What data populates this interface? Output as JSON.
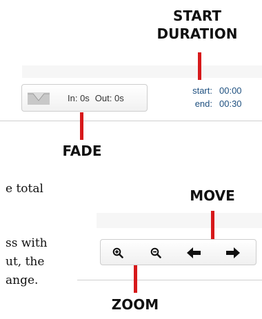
{
  "callouts": {
    "start_duration_line1": "START",
    "start_duration_line2": "DURATION",
    "fade": "FADE",
    "move": "MOVE",
    "zoom": "ZOOM"
  },
  "fade_control": {
    "icon": "fade-curve-icon",
    "in_text": "In: 0s",
    "out_text": "Out: 0s"
  },
  "duration": {
    "start_label": "start:",
    "start_value": "00:00",
    "end_label": "end:",
    "end_value": "00:30"
  },
  "body_text": {
    "line1": "e  total",
    "line2": "ss with",
    "line3": "ut, the",
    "line4": "ange."
  },
  "toolbar": {
    "buttons": [
      {
        "icon": "zoom-in-icon"
      },
      {
        "icon": "zoom-out-icon"
      },
      {
        "icon": "arrow-left-icon"
      },
      {
        "icon": "arrow-right-icon"
      }
    ]
  },
  "colors": {
    "callout_line": "#d7191b",
    "duration_text": "#1d4f7f"
  }
}
